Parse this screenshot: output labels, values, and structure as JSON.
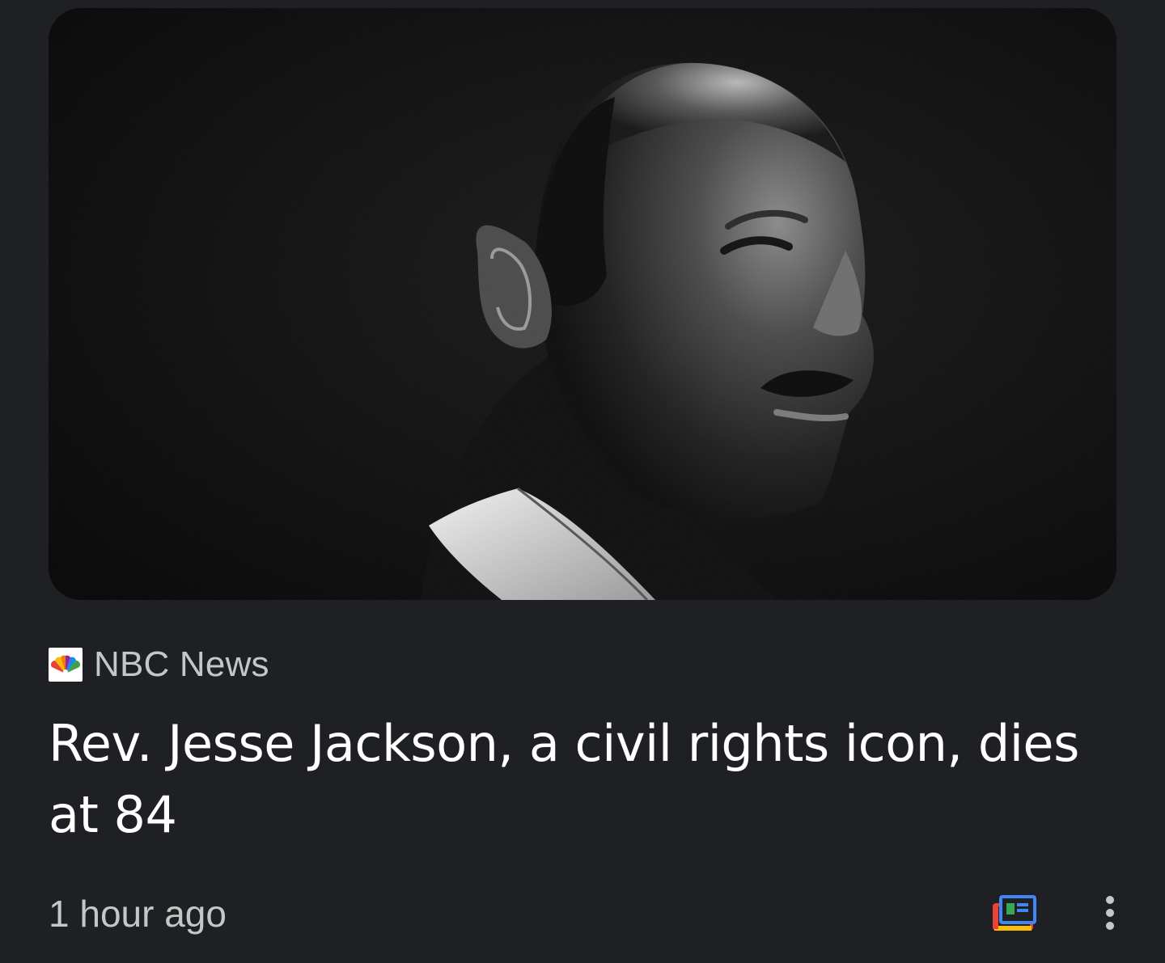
{
  "card": {
    "image_alt": "Black and white portrait of Rev. Jesse Jackson",
    "source": {
      "name": "NBC News",
      "logo_icon": "nbc-peacock-icon"
    },
    "headline": "Rev. Jesse Jackson, a civil rights icon, dies at 84",
    "timestamp": "1 hour ago",
    "actions": {
      "news_icon": "google-news-icon",
      "more_icon": "more-vertical-icon"
    }
  },
  "colors": {
    "background": "#1f2024",
    "headline_text": "#ffffff",
    "secondary_text": "#c4c7c5",
    "news_blue": "#4285f4",
    "news_green": "#34a853",
    "news_yellow": "#fbbc04",
    "news_red": "#ea4335"
  }
}
